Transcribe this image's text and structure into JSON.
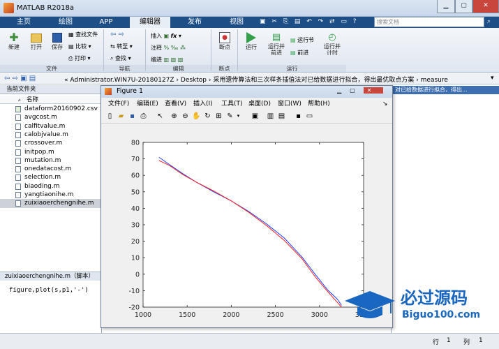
{
  "app": {
    "title": "MATLAB R2018a"
  },
  "tabs": [
    "主页",
    "绘图",
    "APP",
    "编辑器",
    "发布",
    "视图"
  ],
  "search": {
    "placeholder": "搜索文档"
  },
  "ribbon": {
    "file_group": {
      "new": "新建",
      "open": "打开",
      "save": "保存",
      "find_files": "查找文件",
      "compare": "比较",
      "print": "打印",
      "label": "文件"
    },
    "nav_group": {
      "goto": "转至",
      "find": "查找",
      "label": "导航"
    },
    "edit_group": {
      "insert": "插入",
      "comment": "注释",
      "indent": "缩进",
      "fx": "fx",
      "label": "编辑"
    },
    "bp_group": {
      "breakpoints": "断点",
      "label": "断点"
    },
    "run_group": {
      "run": "运行",
      "run_advance": "运行并\n前进",
      "run_section": "运行节",
      "advance": "前进",
      "run_time": "运行并\n计时",
      "label": "运行"
    }
  },
  "address": {
    "path": "« Administrator.WIN7U-20180127Z › Desktop › 采用遗传算法和三次样条插值法对已给数据进行拟合，得出最优取点方案 › measure"
  },
  "left_panel": {
    "header": "当前文件夹",
    "column": "名称",
    "files": [
      "dataform20160902.csv",
      "avgcost.m",
      "calfitvalue.m",
      "calobjvalue.m",
      "crossover.m",
      "initpop.m",
      "mutation.m",
      "onedatacost.m",
      "selection.m",
      "biaoding.m",
      "yangtiaonihe.m",
      "zuixiaoerchengnihe.m"
    ],
    "selected": "zuixiaoerchengnihe.m",
    "detail_header": "zuixiaoerchengnihe.m（脚本）",
    "code": "figure,plot(s,p1,'-')"
  },
  "right_area": {
    "snippet": "对已给数据进行拟合，得出..."
  },
  "figure": {
    "title": "Figure 1",
    "menu": [
      "文件(F)",
      "编辑(E)",
      "查看(V)",
      "插入(I)",
      "工具(T)",
      "桌面(D)",
      "窗口(W)",
      "帮助(H)"
    ]
  },
  "status": {
    "row_label": "行",
    "row": "1",
    "col_label": "列",
    "col": "1"
  },
  "watermark": {
    "text": "必过源码",
    "url": "Biguo100.com"
  },
  "chart_data": {
    "type": "line",
    "xlim": [
      1000,
      3500
    ],
    "ylim": [
      -20,
      80
    ],
    "xticks": [
      1000,
      1500,
      2000,
      2500,
      3000,
      3500
    ],
    "yticks": [
      -20,
      -10,
      0,
      10,
      20,
      30,
      40,
      50,
      60,
      70,
      80
    ],
    "series": [
      {
        "color": "#1f3fff",
        "x": [
          1180,
          1300,
          1450,
          1600,
          1800,
          2000,
          2200,
          2400,
          2600,
          2800,
          2950,
          3100,
          3200,
          3250
        ],
        "y": [
          71,
          66.5,
          61,
          56,
          50,
          44.5,
          38,
          30.5,
          22,
          10.5,
          0,
          -10,
          -15,
          -19
        ]
      },
      {
        "color": "#ff2020",
        "x": [
          1180,
          1300,
          1450,
          1600,
          1800,
          2000,
          2200,
          2400,
          2600,
          2800,
          2950,
          3100,
          3200,
          3250
        ],
        "y": [
          69,
          66,
          60.5,
          56,
          50.5,
          44.5,
          37.5,
          29.5,
          20.5,
          9.5,
          -1.5,
          -11,
          -17,
          -20
        ]
      }
    ]
  }
}
